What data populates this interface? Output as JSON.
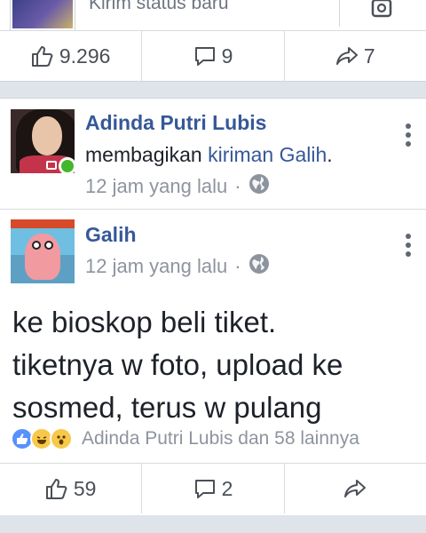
{
  "top_card": {
    "status_prompt": "Kirim status baru",
    "likes": "9.296",
    "comments": "9",
    "shares": "7"
  },
  "shared_post": {
    "sharer_name": "Adinda Putri Lubis",
    "share_text_prefix": "membagikan ",
    "share_text_link": "kiriman Galih",
    "share_text_suffix": ".",
    "sharer_time": "12 jam yang lalu",
    "author_name": "Galih",
    "author_time": "12 jam yang lalu",
    "meta_separator": "·",
    "body_lines": [
      "ke bioskop beli tiket.",
      "tiketnya w foto, upload ke",
      "sosmed, terus w pulang"
    ],
    "reactions_text": "Adinda Putri Lubis dan 58 lainnya",
    "likes": "59",
    "comments": "2"
  },
  "icons": {
    "like": "like-icon",
    "comment": "comment-icon",
    "share": "share-icon",
    "globe": "globe-icon",
    "more": "more-vertical-icon",
    "camera": "camera-icon"
  },
  "colors": {
    "link": "#365899",
    "meta": "#8d949e",
    "online": "#42b72a",
    "like_blue": "#5890ff"
  }
}
